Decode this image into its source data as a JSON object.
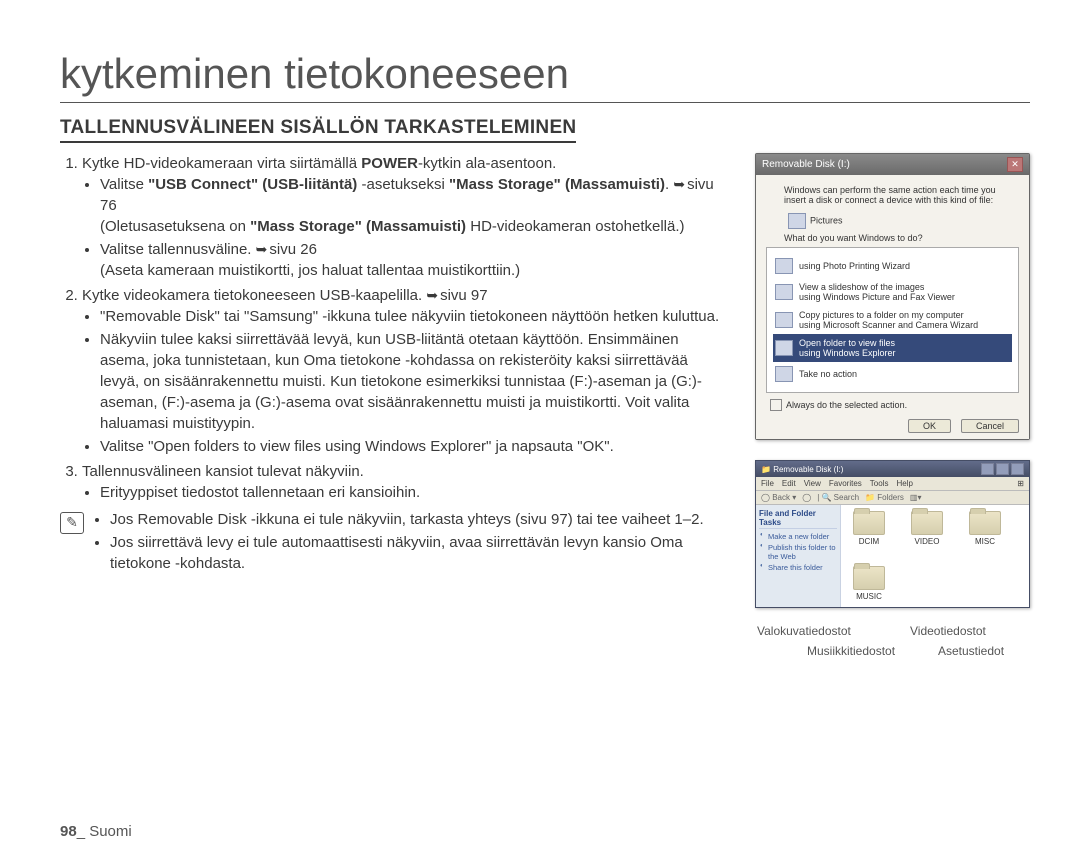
{
  "title": "kytkeminen tietokoneeseen",
  "section": "TALLENNUSVÄLINEEN SISÄLLÖN TARKASTELEMINEN",
  "step1": {
    "intro_a": "Kytke HD-videokameraan virta siirtämällä ",
    "intro_b": "POWER",
    "intro_c": "-kytkin ala-asentoon.",
    "b1_a": "Valitse ",
    "b1_b": "\"USB Connect\" (USB-liitäntä)",
    "b1_c": " -asetukseksi ",
    "b1_d": "\"Mass Storage\" (Massamuisti)",
    "b1_e": ". ",
    "b1_page": "sivu 76",
    "b1_note_a": "(Oletusasetuksena on ",
    "b1_note_b": "\"Mass Storage\" (Massamuisti)",
    "b1_note_c": " HD-videokameran ostohetkellä.)",
    "b2_a": "Valitse tallennusväline. ",
    "b2_page": "sivu 26",
    "b2_note": "(Aseta kameraan muistikortti, jos haluat tallentaa muistikorttiin.)"
  },
  "step2": {
    "intro": "Kytke videokamera tietokoneeseen USB-kaapelilla. ",
    "intro_page": "sivu 97",
    "b1": "\"Removable Disk\" tai \"Samsung\" -ikkuna tulee näkyviin tietokoneen näyttöön hetken kuluttua.",
    "b2": "Näkyviin tulee kaksi siirrettävää levyä, kun USB-liitäntä otetaan käyttöön. Ensimmäinen asema, joka tunnistetaan, kun Oma tietokone -kohdassa on rekisteröity kaksi siirrettävää levyä, on sisäänrakennettu muisti. Kun tietokone esimerkiksi tunnistaa (F:)-aseman ja (G:)-aseman, (F:)-asema ja (G:)-asema ovat sisäänrakennettu muisti ja muistikortti. Voit valita haluamasi muistityypin.",
    "b3": "Valitse \"Open folders to view files using Windows Explorer\" ja napsauta \"OK\"."
  },
  "step3": {
    "intro": "Tallennusvälineen kansiot tulevat näkyviin.",
    "b1": "Erityyppiset tiedostot tallennetaan eri kansioihin."
  },
  "notes": {
    "n1": "Jos Removable Disk -ikkuna ei tule näkyviin, tarkasta yhteys (sivu 97) tai tee vaiheet 1–2.",
    "n2": "Jos siirrettävä levy ei tule automaattisesti näkyviin, avaa siirrettävän levyn kansio Oma tietokone -kohdasta."
  },
  "dialog": {
    "title": "Removable Disk (I:)",
    "msg": "Windows can perform the same action each time you insert a disk or connect a device with this kind of file:",
    "pictures": "Pictures",
    "prompt": "What do you want Windows to do?",
    "items": [
      "using Photo Printing Wizard",
      "View a slideshow of the images\nusing Windows Picture and Fax Viewer",
      "Copy pictures to a folder on my computer\nusing Microsoft Scanner and Camera Wizard",
      "Open folder to view files\nusing Windows Explorer",
      "Take no action"
    ],
    "always": "Always do the selected action.",
    "ok": "OK",
    "cancel": "Cancel"
  },
  "explorer": {
    "title": "Removable Disk (I:)",
    "menu": [
      "File",
      "Edit",
      "View",
      "Favorites",
      "Tools",
      "Help"
    ],
    "toolbar": {
      "back": "Back",
      "search": "Search",
      "folders": "Folders"
    },
    "side_header": "File and Folder Tasks",
    "side_items": [
      "Make a new folder",
      "Publish this folder to the Web",
      "Share this folder"
    ],
    "folders": [
      "DCIM",
      "VIDEO",
      "MISC",
      "MUSIC"
    ]
  },
  "labels": {
    "photo": "Valokuvatiedostot",
    "video": "Videotiedostot",
    "music": "Musiikkitiedostot",
    "settings": "Asetustiedot"
  },
  "footer": {
    "page": "98",
    "sep": "_ ",
    "lang": "Suomi"
  }
}
